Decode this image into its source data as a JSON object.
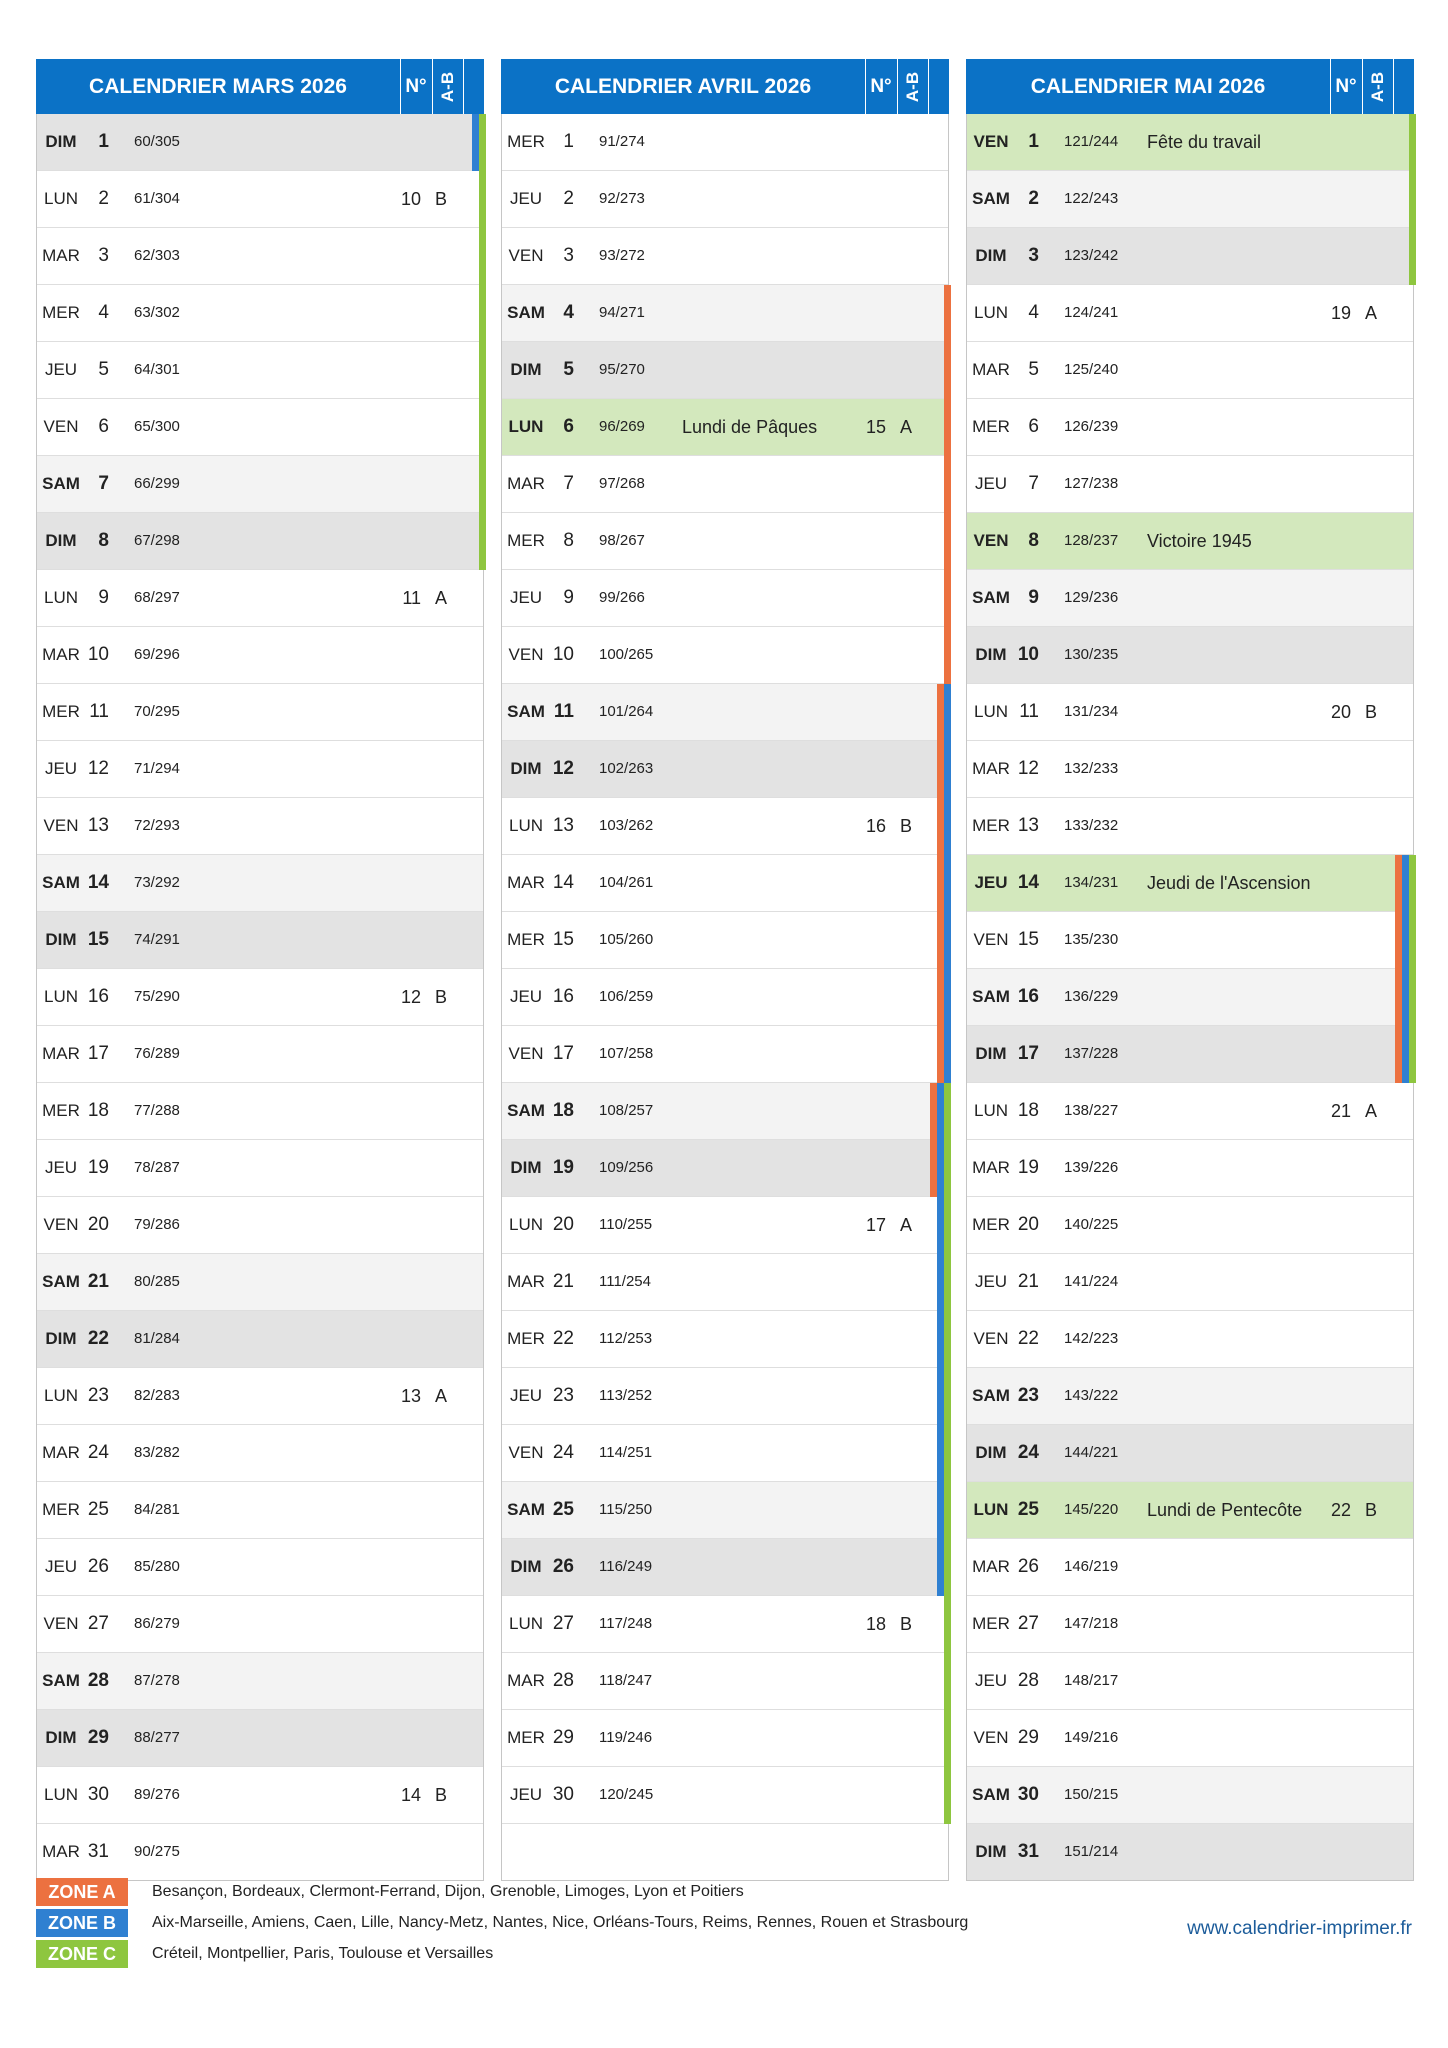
{
  "colors": {
    "header": "#0b72c6",
    "zone_a": "#ec7140",
    "zone_b": "#2f80d1",
    "zone_c": "#8ec63f",
    "holiday": "#d3e8bd"
  },
  "months": [
    {
      "title": "CALENDRIER MARS 2026",
      "no_label": "N°",
      "ab_label": "A-B",
      "days": [
        {
          "dn": "DIM",
          "d": "1",
          "doy": "60/305",
          "type": "sun",
          "zones": [
            "B",
            "C"
          ]
        },
        {
          "dn": "LUN",
          "d": "2",
          "doy": "61/304",
          "wk": "10",
          "ab": "B",
          "zones": [
            "C"
          ]
        },
        {
          "dn": "MAR",
          "d": "3",
          "doy": "62/303",
          "zones": [
            "C"
          ]
        },
        {
          "dn": "MER",
          "d": "4",
          "doy": "63/302",
          "zones": [
            "C"
          ]
        },
        {
          "dn": "JEU",
          "d": "5",
          "doy": "64/301",
          "zones": [
            "C"
          ]
        },
        {
          "dn": "VEN",
          "d": "6",
          "doy": "65/300",
          "zones": [
            "C"
          ]
        },
        {
          "dn": "SAM",
          "d": "7",
          "doy": "66/299",
          "type": "sat",
          "zones": [
            "C"
          ]
        },
        {
          "dn": "DIM",
          "d": "8",
          "doy": "67/298",
          "type": "sun",
          "zones": [
            "C"
          ]
        },
        {
          "dn": "LUN",
          "d": "9",
          "doy": "68/297",
          "wk": "11",
          "ab": "A"
        },
        {
          "dn": "MAR",
          "d": "10",
          "doy": "69/296"
        },
        {
          "dn": "MER",
          "d": "11",
          "doy": "70/295"
        },
        {
          "dn": "JEU",
          "d": "12",
          "doy": "71/294"
        },
        {
          "dn": "VEN",
          "d": "13",
          "doy": "72/293"
        },
        {
          "dn": "SAM",
          "d": "14",
          "doy": "73/292",
          "type": "sat"
        },
        {
          "dn": "DIM",
          "d": "15",
          "doy": "74/291",
          "type": "sun"
        },
        {
          "dn": "LUN",
          "d": "16",
          "doy": "75/290",
          "wk": "12",
          "ab": "B"
        },
        {
          "dn": "MAR",
          "d": "17",
          "doy": "76/289"
        },
        {
          "dn": "MER",
          "d": "18",
          "doy": "77/288"
        },
        {
          "dn": "JEU",
          "d": "19",
          "doy": "78/287"
        },
        {
          "dn": "VEN",
          "d": "20",
          "doy": "79/286"
        },
        {
          "dn": "SAM",
          "d": "21",
          "doy": "80/285",
          "type": "sat"
        },
        {
          "dn": "DIM",
          "d": "22",
          "doy": "81/284",
          "type": "sun"
        },
        {
          "dn": "LUN",
          "d": "23",
          "doy": "82/283",
          "wk": "13",
          "ab": "A"
        },
        {
          "dn": "MAR",
          "d": "24",
          "doy": "83/282"
        },
        {
          "dn": "MER",
          "d": "25",
          "doy": "84/281"
        },
        {
          "dn": "JEU",
          "d": "26",
          "doy": "85/280"
        },
        {
          "dn": "VEN",
          "d": "27",
          "doy": "86/279"
        },
        {
          "dn": "SAM",
          "d": "28",
          "doy": "87/278",
          "type": "sat"
        },
        {
          "dn": "DIM",
          "d": "29",
          "doy": "88/277",
          "type": "sun"
        },
        {
          "dn": "LUN",
          "d": "30",
          "doy": "89/276",
          "wk": "14",
          "ab": "B"
        },
        {
          "dn": "MAR",
          "d": "31",
          "doy": "90/275"
        }
      ]
    },
    {
      "title": "CALENDRIER AVRIL 2026",
      "no_label": "N°",
      "ab_label": "A-B",
      "days": [
        {
          "dn": "MER",
          "d": "1",
          "doy": "91/274"
        },
        {
          "dn": "JEU",
          "d": "2",
          "doy": "92/273"
        },
        {
          "dn": "VEN",
          "d": "3",
          "doy": "93/272"
        },
        {
          "dn": "SAM",
          "d": "4",
          "doy": "94/271",
          "type": "sat",
          "zones": [
            "A"
          ]
        },
        {
          "dn": "DIM",
          "d": "5",
          "doy": "95/270",
          "type": "sun",
          "zones": [
            "A"
          ]
        },
        {
          "dn": "LUN",
          "d": "6",
          "doy": "96/269",
          "type": "hol",
          "note": "Lundi de Pâques",
          "wk": "15",
          "ab": "A",
          "zones": [
            "A"
          ]
        },
        {
          "dn": "MAR",
          "d": "7",
          "doy": "97/268",
          "zones": [
            "A"
          ]
        },
        {
          "dn": "MER",
          "d": "8",
          "doy": "98/267",
          "zones": [
            "A"
          ]
        },
        {
          "dn": "JEU",
          "d": "9",
          "doy": "99/266",
          "zones": [
            "A"
          ]
        },
        {
          "dn": "VEN",
          "d": "10",
          "doy": "100/265",
          "zones": [
            "A"
          ]
        },
        {
          "dn": "SAM",
          "d": "11",
          "doy": "101/264",
          "type": "sat",
          "zones": [
            "A",
            "B"
          ]
        },
        {
          "dn": "DIM",
          "d": "12",
          "doy": "102/263",
          "type": "sun",
          "zones": [
            "A",
            "B"
          ]
        },
        {
          "dn": "LUN",
          "d": "13",
          "doy": "103/262",
          "wk": "16",
          "ab": "B",
          "zones": [
            "A",
            "B"
          ]
        },
        {
          "dn": "MAR",
          "d": "14",
          "doy": "104/261",
          "zones": [
            "A",
            "B"
          ]
        },
        {
          "dn": "MER",
          "d": "15",
          "doy": "105/260",
          "zones": [
            "A",
            "B"
          ]
        },
        {
          "dn": "JEU",
          "d": "16",
          "doy": "106/259",
          "zones": [
            "A",
            "B"
          ]
        },
        {
          "dn": "VEN",
          "d": "17",
          "doy": "107/258",
          "zones": [
            "A",
            "B"
          ]
        },
        {
          "dn": "SAM",
          "d": "18",
          "doy": "108/257",
          "type": "sat",
          "zones": [
            "A",
            "B",
            "C"
          ]
        },
        {
          "dn": "DIM",
          "d": "19",
          "doy": "109/256",
          "type": "sun",
          "zones": [
            "A",
            "B",
            "C"
          ]
        },
        {
          "dn": "LUN",
          "d": "20",
          "doy": "110/255",
          "wk": "17",
          "ab": "A",
          "zones": [
            "B",
            "C"
          ]
        },
        {
          "dn": "MAR",
          "d": "21",
          "doy": "111/254",
          "zones": [
            "B",
            "C"
          ]
        },
        {
          "dn": "MER",
          "d": "22",
          "doy": "112/253",
          "zones": [
            "B",
            "C"
          ]
        },
        {
          "dn": "JEU",
          "d": "23",
          "doy": "113/252",
          "zones": [
            "B",
            "C"
          ]
        },
        {
          "dn": "VEN",
          "d": "24",
          "doy": "114/251",
          "zones": [
            "B",
            "C"
          ]
        },
        {
          "dn": "SAM",
          "d": "25",
          "doy": "115/250",
          "type": "sat",
          "zones": [
            "B",
            "C"
          ]
        },
        {
          "dn": "DIM",
          "d": "26",
          "doy": "116/249",
          "type": "sun",
          "zones": [
            "B",
            "C"
          ]
        },
        {
          "dn": "LUN",
          "d": "27",
          "doy": "117/248",
          "wk": "18",
          "ab": "B",
          "zones": [
            "C"
          ]
        },
        {
          "dn": "MAR",
          "d": "28",
          "doy": "118/247",
          "zones": [
            "C"
          ]
        },
        {
          "dn": "MER",
          "d": "29",
          "doy": "119/246",
          "zones": [
            "C"
          ]
        },
        {
          "dn": "JEU",
          "d": "30",
          "doy": "120/245",
          "zones": [
            "C"
          ]
        },
        {
          "blank": true
        }
      ]
    },
    {
      "title": "CALENDRIER MAI 2026",
      "no_label": "N°",
      "ab_label": "A-B",
      "days": [
        {
          "dn": "VEN",
          "d": "1",
          "doy": "121/244",
          "type": "hol",
          "note": "Fête du travail",
          "zones": [
            "C"
          ]
        },
        {
          "dn": "SAM",
          "d": "2",
          "doy": "122/243",
          "type": "sat",
          "zones": [
            "C"
          ]
        },
        {
          "dn": "DIM",
          "d": "3",
          "doy": "123/242",
          "type": "sun",
          "zones": [
            "C"
          ]
        },
        {
          "dn": "LUN",
          "d": "4",
          "doy": "124/241",
          "wk": "19",
          "ab": "A"
        },
        {
          "dn": "MAR",
          "d": "5",
          "doy": "125/240"
        },
        {
          "dn": "MER",
          "d": "6",
          "doy": "126/239"
        },
        {
          "dn": "JEU",
          "d": "7",
          "doy": "127/238"
        },
        {
          "dn": "VEN",
          "d": "8",
          "doy": "128/237",
          "type": "hol",
          "note": "Victoire 1945"
        },
        {
          "dn": "SAM",
          "d": "9",
          "doy": "129/236",
          "type": "sat"
        },
        {
          "dn": "DIM",
          "d": "10",
          "doy": "130/235",
          "type": "sun"
        },
        {
          "dn": "LUN",
          "d": "11",
          "doy": "131/234",
          "wk": "20",
          "ab": "B"
        },
        {
          "dn": "MAR",
          "d": "12",
          "doy": "132/233"
        },
        {
          "dn": "MER",
          "d": "13",
          "doy": "133/232"
        },
        {
          "dn": "JEU",
          "d": "14",
          "doy": "134/231",
          "type": "hol",
          "note": "Jeudi de l'Ascension",
          "zones": [
            "A",
            "B",
            "C"
          ]
        },
        {
          "dn": "VEN",
          "d": "15",
          "doy": "135/230",
          "zones": [
            "A",
            "B",
            "C"
          ]
        },
        {
          "dn": "SAM",
          "d": "16",
          "doy": "136/229",
          "type": "sat",
          "zones": [
            "A",
            "B",
            "C"
          ]
        },
        {
          "dn": "DIM",
          "d": "17",
          "doy": "137/228",
          "type": "sun",
          "zones": [
            "A",
            "B",
            "C"
          ]
        },
        {
          "dn": "LUN",
          "d": "18",
          "doy": "138/227",
          "wk": "21",
          "ab": "A"
        },
        {
          "dn": "MAR",
          "d": "19",
          "doy": "139/226"
        },
        {
          "dn": "MER",
          "d": "20",
          "doy": "140/225"
        },
        {
          "dn": "JEU",
          "d": "21",
          "doy": "141/224"
        },
        {
          "dn": "VEN",
          "d": "22",
          "doy": "142/223"
        },
        {
          "dn": "SAM",
          "d": "23",
          "doy": "143/222",
          "type": "sat"
        },
        {
          "dn": "DIM",
          "d": "24",
          "doy": "144/221",
          "type": "sun"
        },
        {
          "dn": "LUN",
          "d": "25",
          "doy": "145/220",
          "type": "hol",
          "note": "Lundi de Pentecôte",
          "wk": "22",
          "ab": "B"
        },
        {
          "dn": "MAR",
          "d": "26",
          "doy": "146/219"
        },
        {
          "dn": "MER",
          "d": "27",
          "doy": "147/218"
        },
        {
          "dn": "JEU",
          "d": "28",
          "doy": "148/217"
        },
        {
          "dn": "VEN",
          "d": "29",
          "doy": "149/216"
        },
        {
          "dn": "SAM",
          "d": "30",
          "doy": "150/215",
          "type": "sat"
        },
        {
          "dn": "DIM",
          "d": "31",
          "doy": "151/214",
          "type": "sun"
        }
      ]
    }
  ],
  "legend": [
    {
      "label": "ZONE A",
      "color": "#ec7140",
      "text": "Besançon, Bordeaux, Clermont-Ferrand, Dijon, Grenoble, Limoges, Lyon et Poitiers"
    },
    {
      "label": "ZONE B",
      "color": "#2f80d1",
      "text": "Aix-Marseille, Amiens, Caen, Lille, Nancy-Metz, Nantes, Nice, Orléans-Tours, Reims, Rennes, Rouen et Strasbourg"
    },
    {
      "label": "ZONE C",
      "color": "#8ec63f",
      "text": "Créteil, Montpellier, Paris, Toulouse et Versailles"
    }
  ],
  "website": "www.calendrier-imprimer.fr"
}
